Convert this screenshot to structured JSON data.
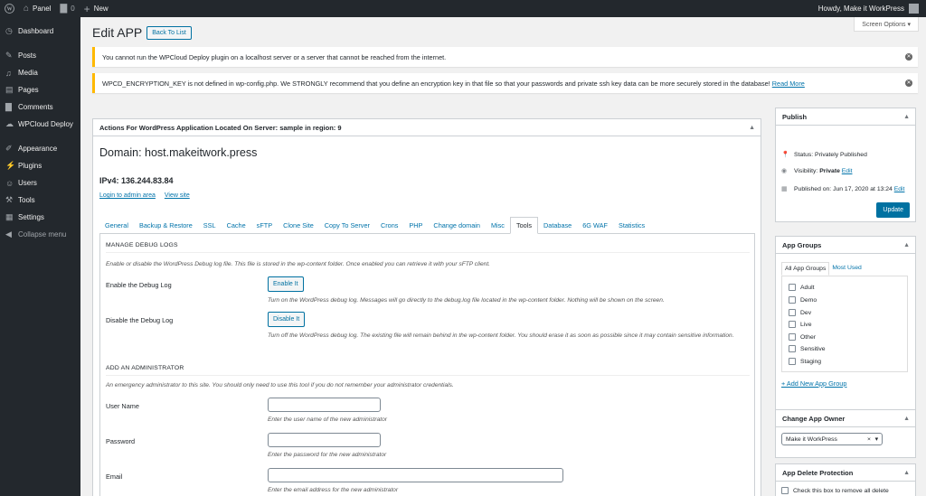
{
  "adminbar": {
    "wp_icon": "wordpress-logo-icon",
    "site": "Panel",
    "comments_count": "0",
    "new_label": "New",
    "howdy": "Howdy, Make it WorkPress"
  },
  "menu": {
    "items": [
      {
        "label": "Dashboard",
        "icon": "dashboard-icon"
      },
      {
        "label": "Posts",
        "icon": "pin-icon"
      },
      {
        "label": "Media",
        "icon": "media-icon"
      },
      {
        "label": "Pages",
        "icon": "pages-icon"
      },
      {
        "label": "Comments",
        "icon": "comments-icon"
      },
      {
        "label": "WPCloud Deploy",
        "icon": "cloud-icon"
      },
      {
        "label": "Appearance",
        "icon": "brush-icon"
      },
      {
        "label": "Plugins",
        "icon": "plugin-icon"
      },
      {
        "label": "Users",
        "icon": "users-icon"
      },
      {
        "label": "Tools",
        "icon": "wrench-icon"
      },
      {
        "label": "Settings",
        "icon": "settings-icon"
      },
      {
        "label": "Collapse menu",
        "icon": "collapse-icon"
      }
    ]
  },
  "screen_options": "Screen Options ▾",
  "page": {
    "title": "Edit APP",
    "back_label": "Back To List"
  },
  "notices": [
    {
      "text": "You cannot run the WPCloud Deploy plugin on a localhost server or a server that cannot be reached from the internet."
    },
    {
      "text": "WPCD_ENCRYPTION_KEY is not defined in wp-config.php. We STRONGLY recommend that you define an encryption key in that file so that your passwords and private ssh key data can be more securely stored in the database!",
      "link": "Read More"
    }
  ],
  "main": {
    "header": "Actions For WordPress Application Located On Server: sample in region: 9",
    "domain": "Domain: host.makeitwork.press",
    "ipv4": "IPv4: 136.244.83.84",
    "links": [
      "Login to admin area",
      "View site"
    ],
    "tabs": [
      "General",
      "Backup & Restore",
      "SSL",
      "Cache",
      "sFTP",
      "Clone Site",
      "Copy To Server",
      "Crons",
      "PHP",
      "Change domain",
      "Misc",
      "Tools",
      "Database",
      "6G WAF",
      "Statistics"
    ],
    "active_tab": "Tools",
    "debug": {
      "section": "MANAGE DEBUG LOGS",
      "desc": "Enable or disable the WordPress Debug log file. This file is stored in the wp-content folder. Once enabled you can retrieve it with your sFTP client.",
      "enable_label": "Enable the Debug Log",
      "enable_btn": "Enable It",
      "enable_desc": "Turn on the WordPress debug log. Messages will go directly to the debug.log file located in the wp-content folder. Nothing will be shown on the screen.",
      "disable_label": "Disable the Debug Log",
      "disable_btn": "Disable It",
      "disable_desc": "Turn off the WordPress debug log. The existing file will remain behind in the wp-content folder. You should erase it as soon as possible since it may contain sensitive information."
    },
    "admin": {
      "section": "ADD AN ADMINISTRATOR",
      "desc": "An emergency administrator to this site. You should only need to use this tool if you do not remember your administrator credentials.",
      "user_label": "User Name",
      "user_desc": "Enter the user name of the new administrator",
      "pass_label": "Password",
      "pass_desc": "Enter the password for the new administrator",
      "email_label": "Email",
      "email_desc": "Enter the email address for the new administrator"
    }
  },
  "publish": {
    "title": "Publish",
    "status": "Status: Privately Published",
    "visibility_prefix": "Visibility: ",
    "visibility": "Private",
    "edit": "Edit",
    "published": "Published on: Jun 17, 2020 at 13:24",
    "update": "Update"
  },
  "groups": {
    "title": "App Groups",
    "tabs": [
      "All App Groups",
      "Most Used"
    ],
    "items": [
      "Adult",
      "Demo",
      "Dev",
      "Live",
      "Other",
      "Sensitive",
      "Staging"
    ],
    "add": "+ Add New App Group"
  },
  "owner": {
    "title": "Change App Owner",
    "value": "Make it WorkPress",
    "clear": "×",
    "arrow": "▾"
  },
  "delete_protection": {
    "title": "App Delete Protection",
    "check_label": "Check this box to remove all delete"
  },
  "colors": {
    "admin_bar": "#23282d",
    "accent": "#0073aa",
    "warning": "#ffb900",
    "button": "#0071a1"
  }
}
